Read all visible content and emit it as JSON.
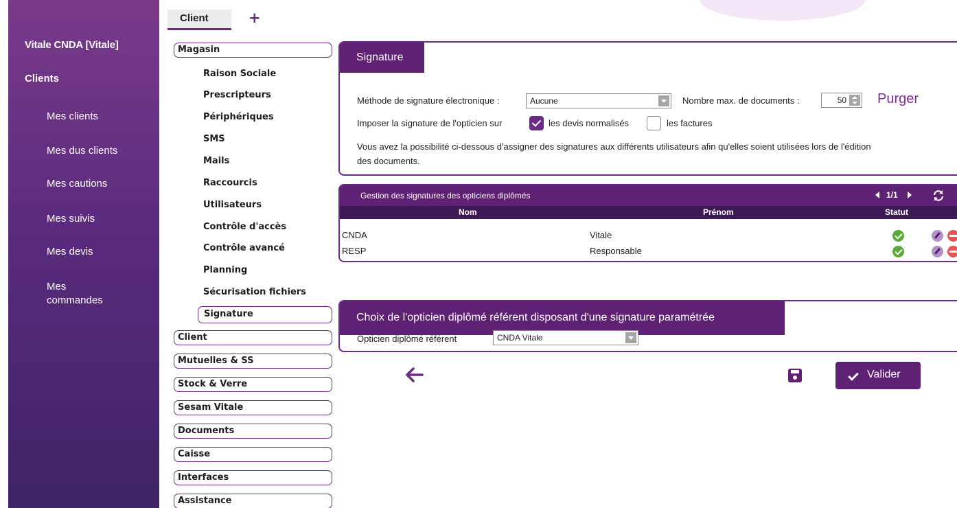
{
  "sidebar": {
    "title": "Vitale CNDA [Vitale]",
    "section": "Clients",
    "items": [
      {
        "label": "Mes clients"
      },
      {
        "label": "Mes dus clients"
      },
      {
        "label": "Mes cautions"
      },
      {
        "label": "Mes suivis"
      },
      {
        "label": "Mes devis"
      },
      {
        "label": "Mes\ncommandes"
      }
    ]
  },
  "tabs": {
    "active": "Client",
    "add": "+"
  },
  "menu": {
    "magasin": "Magasin",
    "magasin_items": [
      "Raison Sociale",
      "Prescripteurs",
      "Périphériques",
      "SMS",
      "Mails",
      "Raccourcis",
      "Utilisateurs",
      "Contrôle d'accès",
      "Contrôle avancé",
      "Planning",
      "Sécurisation fichiers"
    ],
    "active_item": "Signature",
    "groups": [
      "Client",
      "Mutuelles & SS",
      "Stock & Verre",
      "Sesam Vitale",
      "Documents",
      "Caisse",
      "Interfaces",
      "Assistance"
    ]
  },
  "signature_panel": {
    "title": "Signature",
    "method_label": "Méthode de signature électronique :",
    "method_value": "Aucune",
    "max_docs_label": "Nombre max. de documents :",
    "max_docs_value": "50",
    "purger": "Purger",
    "impose_label": "Imposer la signature de l'opticien sur",
    "devis_label": "les devis normalisés",
    "devis_checked": true,
    "factures_label": "les factures",
    "factures_checked": false,
    "info_line1": "Vous avez la possibilité ci-dessous d'assigner des signatures aux différents utilisateurs afin qu'elles soient utilisées lors de l'édition",
    "info_line2": "des documents."
  },
  "grid": {
    "title": "Gestion des signatures des opticiens diplômés",
    "pager": "1/1",
    "columns": {
      "nom": "Nom",
      "prenom": "Prénom",
      "statut": "Statut"
    },
    "rows": [
      {
        "nom": "CNDA",
        "prenom": "Vitale"
      },
      {
        "nom": "RESP",
        "prenom": "Responsable"
      }
    ]
  },
  "referent_panel": {
    "title": "Choix de l'opticien diplômé référent disposant d'une signature paramétrée",
    "label": "Opticien diplômé référent",
    "value": "CNDA Vitale"
  },
  "actions": {
    "valider": "Valider"
  },
  "colors": {
    "primary": "#5f2173",
    "accent": "#6b2a85",
    "grid_header": "#3d1a55",
    "ok": "#5aaa3a",
    "delete": "#e25656"
  }
}
